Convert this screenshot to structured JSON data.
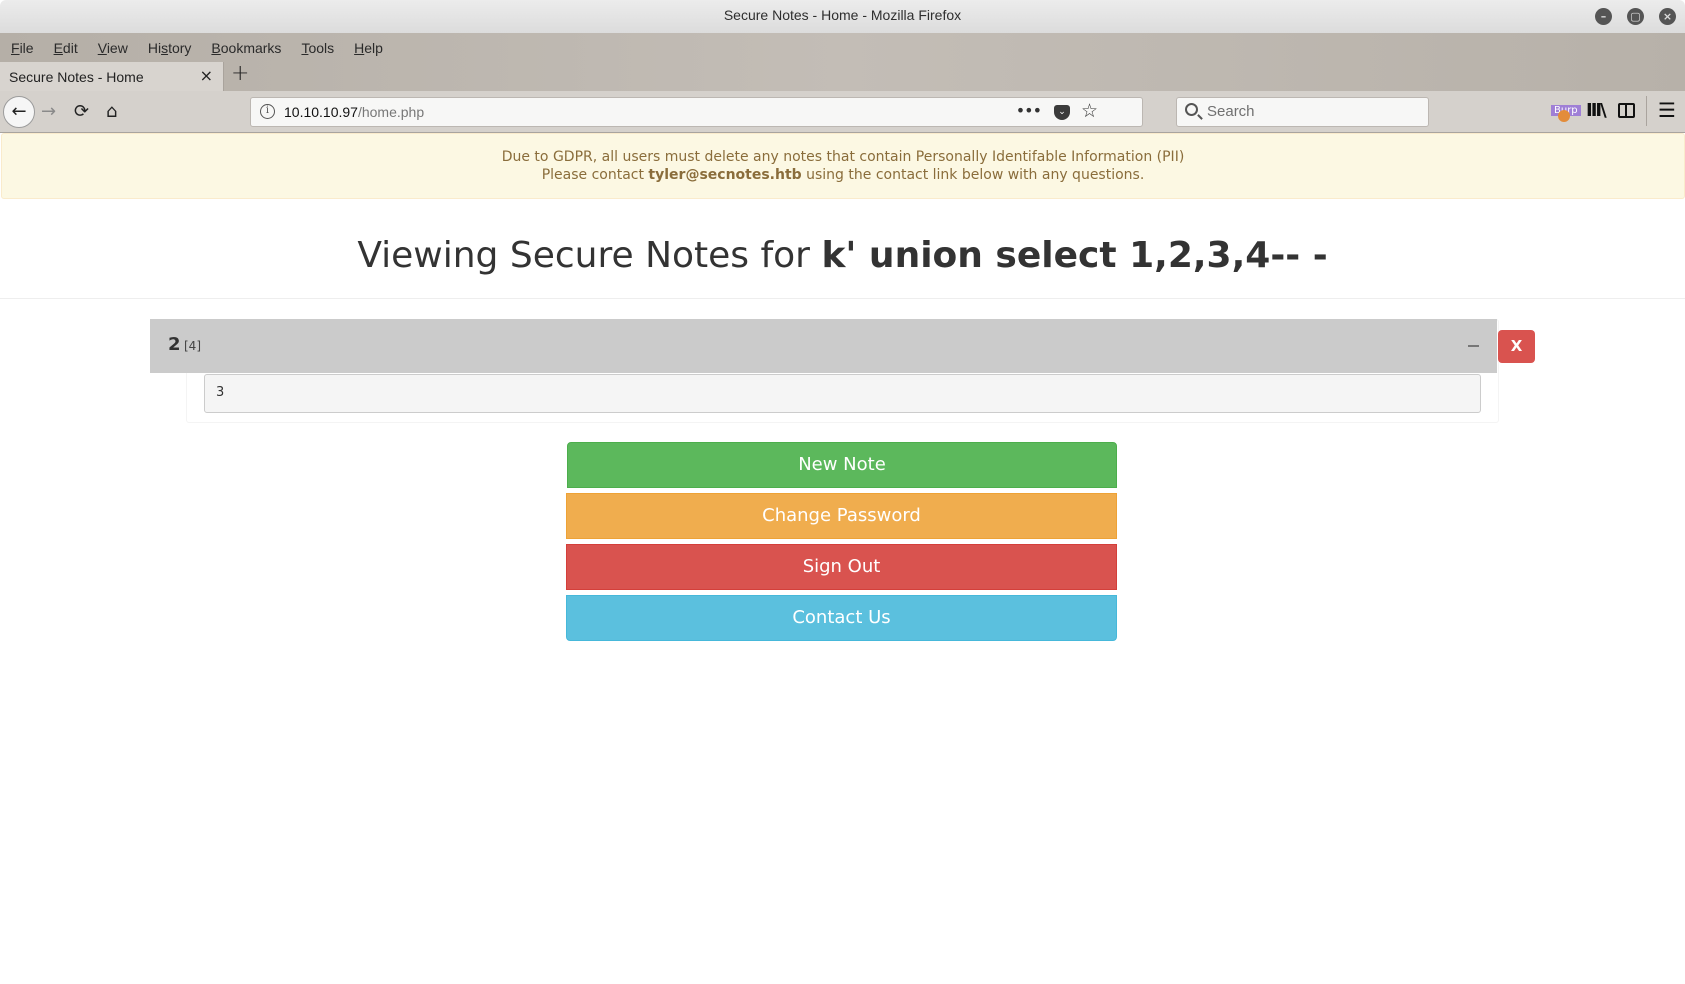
{
  "window": {
    "title": "Secure Notes - Home - Mozilla Firefox",
    "controls": [
      "minimize-icon",
      "maximize-icon",
      "close-icon"
    ]
  },
  "menu": {
    "items": [
      {
        "label": "File",
        "accel": "F"
      },
      {
        "label": "Edit",
        "accel": "E"
      },
      {
        "label": "View",
        "accel": "V"
      },
      {
        "label": "History",
        "accel": "s"
      },
      {
        "label": "Bookmarks",
        "accel": "B"
      },
      {
        "label": "Tools",
        "accel": "T"
      },
      {
        "label": "Help",
        "accel": "H"
      }
    ]
  },
  "tabs": [
    {
      "title": "Secure Notes - Home",
      "close": "×"
    }
  ],
  "newtab": "+",
  "nav": {
    "back": "←",
    "forward": "→",
    "reload": "⟳",
    "home": "⌂",
    "url_host": "10.10.10.97",
    "url_path": "/home.php",
    "page_actions": "•••",
    "bookmark": "☆",
    "search_placeholder": "Search",
    "extension_badge": "Burp",
    "library": "III\\",
    "menu": "☰"
  },
  "alert": {
    "line1": "Due to GDPR, all users must delete any notes that contain Personally Identifable Information (PII)",
    "line2_pre": "Please contact ",
    "line2_email": "tyler@secnotes.htb",
    "line2_post": " using the contact link below with any questions."
  },
  "heading": {
    "prefix": "Viewing Secure Notes for ",
    "username": "k' union select 1,2,3,4-- -"
  },
  "notes": [
    {
      "title": "2",
      "id": "[4]",
      "body": "3",
      "delete_label": "X"
    }
  ],
  "buttons": {
    "new_note": "New Note",
    "change_password": "Change Password",
    "sign_out": "Sign Out",
    "contact_us": "Contact Us"
  },
  "colors": {
    "success": "#5cb85c",
    "warning": "#f0ad4e",
    "danger": "#d9534f",
    "info": "#5bc0de",
    "alert_bg": "#fcf8e3",
    "alert_text": "#8a6d3b"
  }
}
